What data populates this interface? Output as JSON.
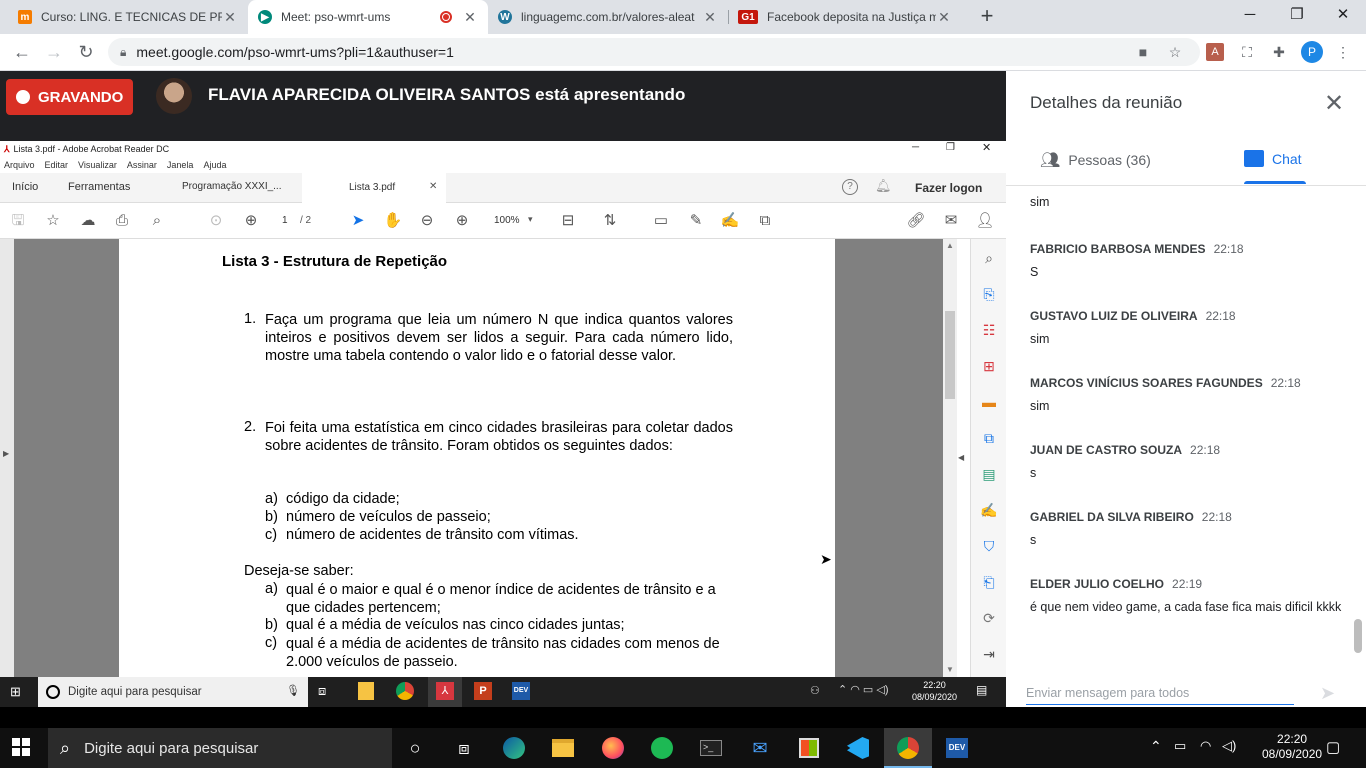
{
  "browser": {
    "tabs": [
      {
        "title": "Curso: LING. E TECNICAS DE PRO",
        "active": false
      },
      {
        "title": "Meet: pso-wmrt-ums",
        "active": true
      },
      {
        "title": "linguagemc.com.br/valores-aleat",
        "active": false
      },
      {
        "title": "Facebook deposita na Justiça mu",
        "active": false
      }
    ],
    "url": "meet.google.com/pso-wmrt-ums?pli=1&authuser=1",
    "profile_initial": "P"
  },
  "meet": {
    "recording_label": "GRAVANDO",
    "presenting_text": "FLAVIA APARECIDA OLIVEIRA SANTOS está apresentando"
  },
  "acrobat": {
    "window_title": "Lista 3.pdf - Adobe Acrobat Reader DC",
    "menu": [
      "Arquivo",
      "Editar",
      "Visualizar",
      "Assinar",
      "Janela",
      "Ajuda"
    ],
    "tabs": {
      "home": "Início",
      "tools": "Ferramentas",
      "doc1": "Programação XXXI_...",
      "doc2": "Lista 3.pdf"
    },
    "login": "Fazer logon",
    "page_current": "1",
    "page_total": "/ 2",
    "zoom": "100%"
  },
  "document": {
    "heading": "Lista 3 - Estrutura de Repetição",
    "q1_num": "1.",
    "q1_text": "Faça um programa que leia um número N que indica quantos valores inteiros e positivos devem ser lidos a seguir. Para cada número lido, mostre uma tabela contendo o valor lido e o fatorial desse valor.",
    "q2_num": "2.",
    "q2_text": "Foi feita uma estatística em cinco cidades brasileiras para coletar dados sobre acidentes de trânsito. Foram obtidos os seguintes dados:",
    "q2_items": [
      {
        "letter": "a)",
        "text": "código da cidade;"
      },
      {
        "letter": "b)",
        "text": "número de veículos de passeio;"
      },
      {
        "letter": "c)",
        "text": "número de acidentes de trânsito com vítimas."
      }
    ],
    "want_label": "Deseja-se saber:",
    "want_items": [
      {
        "letter": "a)",
        "text": "qual é o maior e qual é o menor índice de acidentes de trânsito e a que cidades pertencem;"
      },
      {
        "letter": "b)",
        "text": "qual é a média de veículos nas cinco cidades juntas;"
      },
      {
        "letter": "c)",
        "text": "qual é a média de acidentes de trânsito nas cidades com menos de 2.000 veículos de passeio."
      }
    ]
  },
  "inner_taskbar": {
    "search": "Digite aqui para pesquisar",
    "time": "22:20",
    "date": "08/09/2020"
  },
  "panel": {
    "title": "Detalhes da reunião",
    "people_tab": "Pessoas (36)",
    "chat_tab": "Chat",
    "partial_text": "sim",
    "messages": [
      {
        "sender": "FABRICIO BARBOSA MENDES",
        "time": "22:18",
        "text": "S"
      },
      {
        "sender": "GUSTAVO LUIZ DE OLIVEIRA",
        "time": "22:18",
        "text": "sim"
      },
      {
        "sender": "MARCOS VINÍCIUS SOARES FAGUNDES",
        "time": "22:18",
        "text": "sim"
      },
      {
        "sender": "JUAN DE CASTRO SOUZA",
        "time": "22:18",
        "text": "s"
      },
      {
        "sender": "GABRIEL DA SILVA RIBEIRO",
        "time": "22:18",
        "text": "s"
      },
      {
        "sender": "ELDER JULIO COELHO",
        "time": "22:19",
        "text": "é que nem video game, a cada fase fica mais dificil kkkk"
      }
    ],
    "input_placeholder": "Enviar mensagem para todos"
  },
  "taskbar": {
    "search": "Digite aqui para pesquisar",
    "time": "22:20",
    "date": "08/09/2020"
  }
}
